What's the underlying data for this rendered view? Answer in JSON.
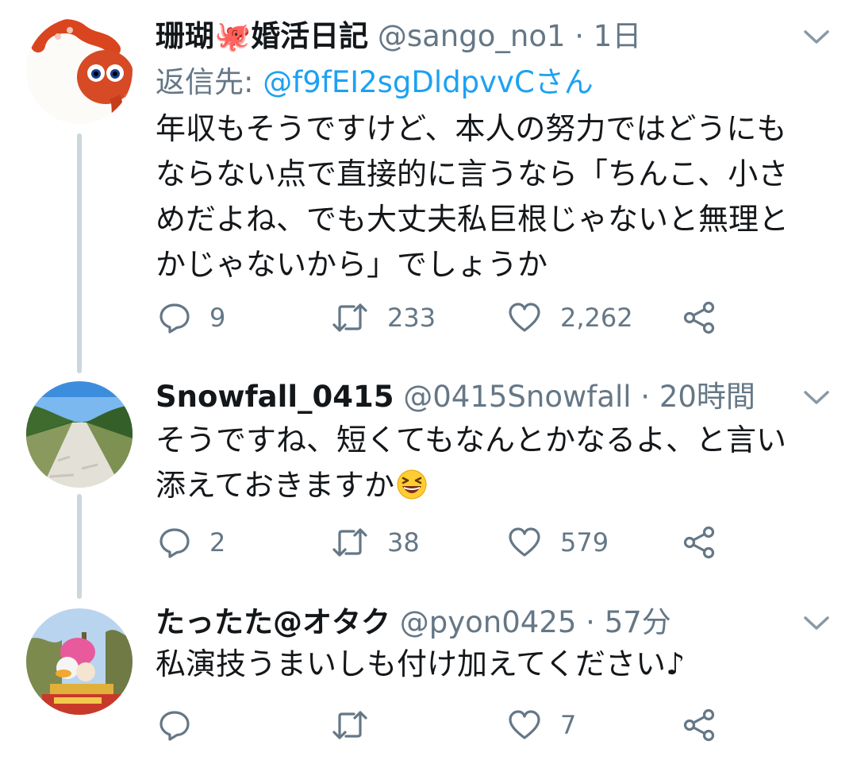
{
  "tweets": [
    {
      "name": "珊瑚🐙婚活日記",
      "handle": "@sango_no1",
      "dot": "·",
      "time": "1日",
      "reply_prefix": "返信先: ",
      "reply_mention": "@f9fEI2sgDldpvvCさん",
      "lines": [
        "年収もそうですけど、本人の努力ではどうにも",
        "ならない点で直接的に言うなら「ちんこ、小さ",
        "めだよね、でも大丈夫私巨根じゃないと無理と",
        "かじゃないから」でしょうか"
      ],
      "replies": "9",
      "retweets": "233",
      "likes": "2,262"
    },
    {
      "name": "Snowfall_0415",
      "handle": "@0415Snowfall",
      "dot": "·",
      "time": "20時間",
      "lines": [
        "そうですね、短くてもなんとかなるよ、と言い",
        "添えておきますか"
      ],
      "replies": "2",
      "retweets": "38",
      "likes": "579"
    },
    {
      "name": "たったた@オタク",
      "handle": "@pyon0425",
      "dot": "·",
      "time": "57分",
      "lines": [
        "私演技うまいしも付け加えてください♪"
      ],
      "replies": "",
      "retweets": "",
      "likes": "7"
    }
  ],
  "icons": [
    "reply-icon",
    "retweet-icon",
    "like-icon",
    "share-icon",
    "chevron-down-icon",
    "laughing-emoji-icon"
  ],
  "colors": {
    "text": "#14171a",
    "secondary": "#657786",
    "link": "#1da1f2",
    "thread_line": "#ccd6dd"
  }
}
